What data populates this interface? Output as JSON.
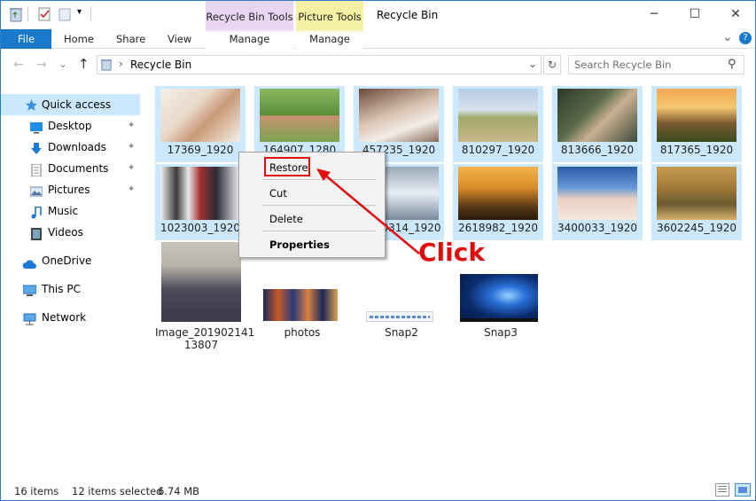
{
  "window": {
    "title": "Recycle Bin",
    "minimize_glyph": "─",
    "maximize_glyph": "☐",
    "close_glyph": "✕",
    "qat_dropdown_glyph": "▾"
  },
  "context_tabs": {
    "recycle_bin_tools": "Recycle Bin Tools",
    "picture_tools": "Picture Tools",
    "manage_1": "Manage",
    "manage_2": "Manage"
  },
  "ribbon": {
    "file": "File",
    "home": "Home",
    "share": "Share",
    "view": "View",
    "collapse_glyph": "⌄",
    "help_glyph": "?"
  },
  "address": {
    "back_glyph": "←",
    "forward_glyph": "→",
    "recent_glyph": "⌄",
    "up_glyph": "↑",
    "separator": "›",
    "path": "Recycle Bin",
    "dropdown_glyph": "⌄",
    "refresh_glyph": "↻",
    "search_placeholder": "Search Recycle Bin",
    "search_glyph": "⚲"
  },
  "nav": {
    "quick_access": "Quick access",
    "desktop": "Desktop",
    "downloads": "Downloads",
    "documents": "Documents",
    "pictures": "Pictures",
    "music": "Music",
    "videos": "Videos",
    "onedrive": "OneDrive",
    "this_pc": "This PC",
    "network": "Network",
    "pin_glyph": "📌"
  },
  "files": {
    "row1": [
      "17369_1920",
      "164907_1280",
      "457235_1920",
      "810297_1920",
      "813666_1920",
      "817365_1920"
    ],
    "row2": [
      "1023003_1920",
      "",
      "2900314_1920",
      "2618982_1920",
      "3400033_1920",
      "3602245_1920"
    ],
    "row2_visible_3": "0314_1920",
    "row1_visible_2": "164907_1280",
    "row1_visible_3": "457235_1920",
    "row3": {
      "image_line1": "Image_201902141",
      "image_line2": "13807",
      "photos": "photos",
      "snap2": "Snap2",
      "snap3": "Snap3"
    }
  },
  "context_menu": {
    "restore": "Restore",
    "cut": "Cut",
    "delete": "Delete",
    "properties": "Properties"
  },
  "annotation": {
    "click_label": "Click",
    "color": "#e20b0b"
  },
  "status": {
    "items": "16 items",
    "selected": "12 items selected",
    "size": "6.74 MB"
  },
  "colors": {
    "selection": "#cce8ff",
    "file_tab": "#1979ca",
    "recycle_context": "#e8d5f1",
    "picture_context": "#f5f0a3"
  }
}
